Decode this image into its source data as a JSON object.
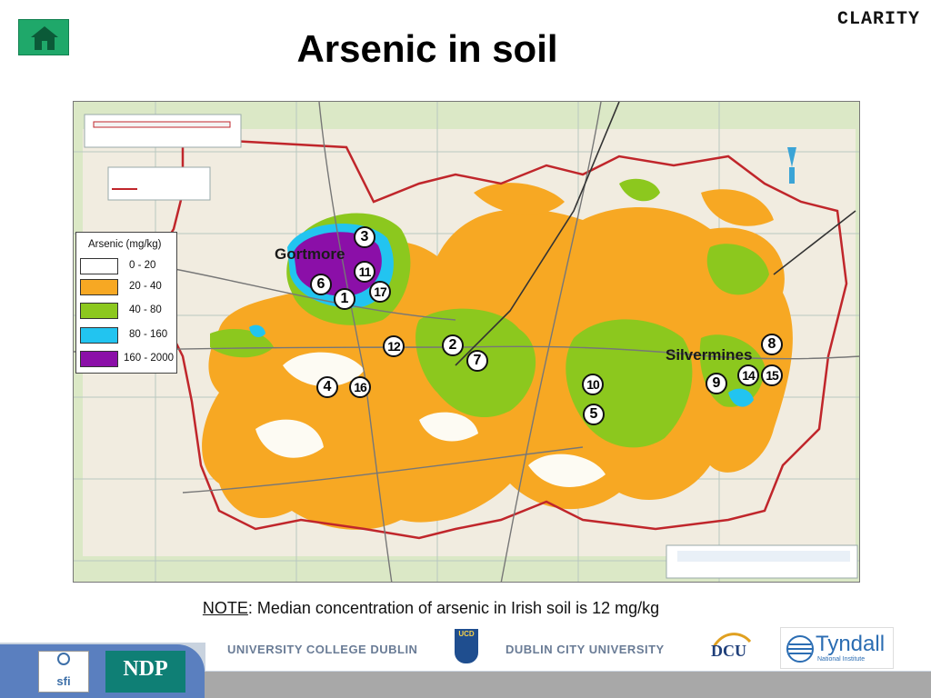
{
  "header": {
    "brand": "CLARITY",
    "title": "Arsenic in soil"
  },
  "icons": {
    "home": "home-icon"
  },
  "colors": {
    "home_button": "#1fa86a",
    "class_0_20": "#ffffff",
    "class_20_40": "#f7a823",
    "class_40_80": "#8cc81e",
    "class_80_160": "#22c4f0",
    "class_160_2000": "#8b0fa8",
    "boundary": "#c0262b"
  },
  "legend": {
    "title": "Arsenic (mg/kg)",
    "items": [
      {
        "label": "0 - 20",
        "color": "#ffffff"
      },
      {
        "label": "20 - 40",
        "color": "#f7a823"
      },
      {
        "label": "40 - 80",
        "color": "#8cc81e"
      },
      {
        "label": "80 - 160",
        "color": "#22c4f0"
      },
      {
        "label": "160 - 2000",
        "color": "#8b0fa8"
      }
    ]
  },
  "places": {
    "gortmore": "Gortmore",
    "silvermines": "Silvermines"
  },
  "markers": [
    "3",
    "11",
    "6",
    "17",
    "1",
    "12",
    "2",
    "7",
    "4",
    "16",
    "10",
    "5",
    "8",
    "9",
    "14",
    "15"
  ],
  "note": {
    "label": "NOTE",
    "text": ": Median concentration of arsenic in Irish soil is 12 mg/kg"
  },
  "footer": {
    "ucd": "UNIVERSITY COLLEGE DUBLIN",
    "dcu": "DUBLIN CITY UNIVERSITY",
    "dcu_logo": "DCU",
    "tyndall": "Tyndall",
    "tyndall_sub": "National Institute",
    "sfi": "sfi",
    "ndp": "NDP",
    "ucd_crest": "UCD"
  }
}
